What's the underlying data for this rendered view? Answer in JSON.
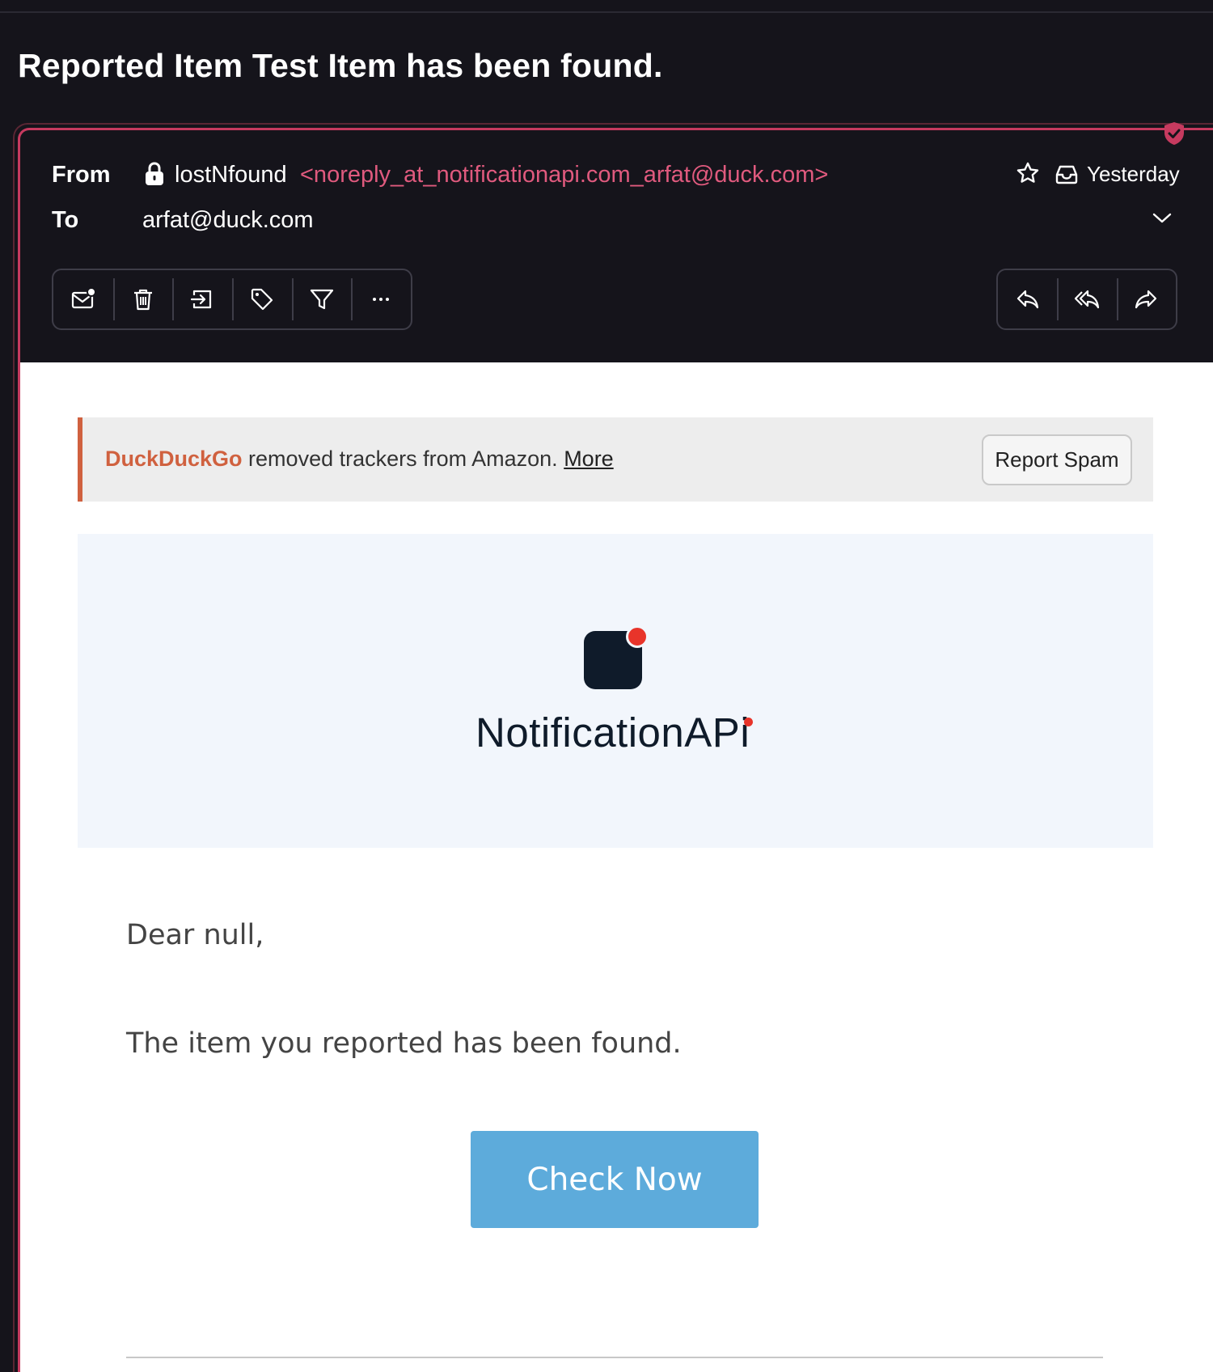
{
  "subject": "Reported Item Test Item has been found.",
  "header": {
    "from_label": "From",
    "to_label": "To",
    "sender_name": "lostNfound",
    "sender_address": "<noreply_at_notificationapi.com_arfat@duck.com>",
    "to_address": "arfat@duck.com",
    "date": "Yesterday"
  },
  "toolbar": {
    "left": [
      "mark-unread-icon",
      "trash-icon",
      "move-icon",
      "tag-icon",
      "filter-icon",
      "more-icon"
    ],
    "right": [
      "reply-icon",
      "reply-all-icon",
      "forward-icon"
    ]
  },
  "tracker_notice": {
    "brand": "DuckDuckGo",
    "text": " removed trackers from Amazon. ",
    "more_link": "More",
    "report_spam": "Report Spam"
  },
  "email": {
    "logo_text": "NotificationAP",
    "logo_text_tail": "i",
    "greeting": "Dear null,",
    "message": "The item you reported has been found.",
    "cta_label": "Check Now"
  },
  "colors": {
    "accent": "#c63a5f",
    "sender_address": "#e05a7e",
    "duckduckgo": "#d0613f",
    "cta": "#5dabdb",
    "logo_dark": "#0f1b2a",
    "logo_red": "#e8342a"
  }
}
